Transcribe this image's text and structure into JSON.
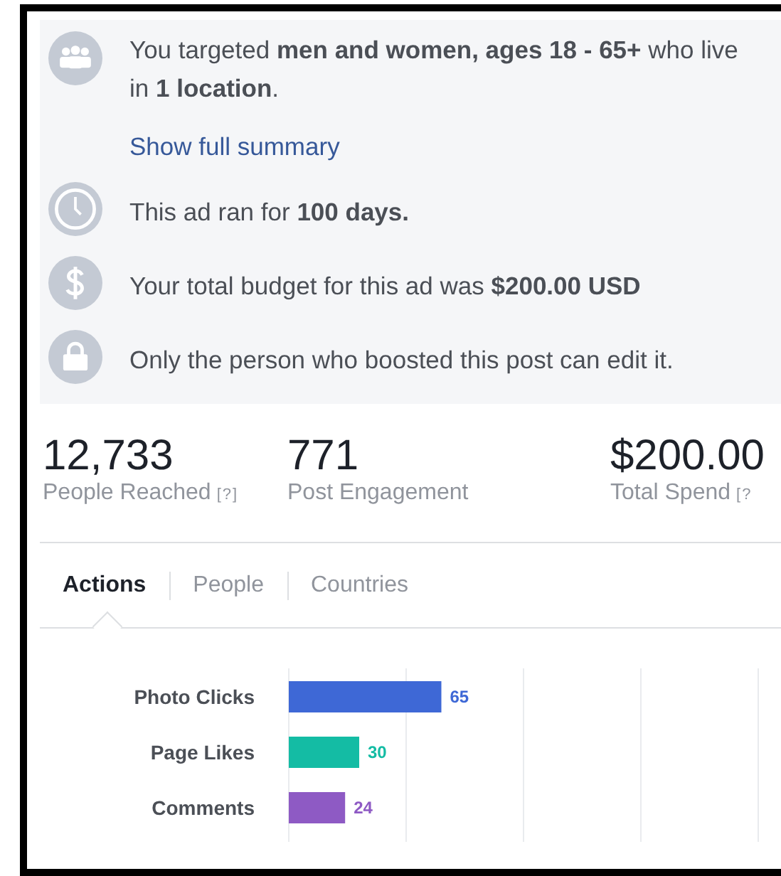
{
  "summary": {
    "items": [
      {
        "kind": "audience",
        "text": "You targeted **men and women, ages 18 - 65+** who live in **1 location**.",
        "link": "Show full summary"
      },
      {
        "kind": "duration",
        "text": "This ad ran for **100 days.**"
      },
      {
        "kind": "budget",
        "text": "Your total budget for this ad was **$200.00 USD**"
      },
      {
        "kind": "lock",
        "text": "Only the person who boosted this post can edit it."
      }
    ]
  },
  "stats": [
    {
      "value": "12,733",
      "label": "People Reached",
      "help": "[?]"
    },
    {
      "value": "771",
      "label": "Post Engagement"
    },
    {
      "value": "$200.00",
      "label": "Total Spend",
      "help": "[?"
    }
  ],
  "tabs": [
    {
      "label": "Actions",
      "selected": true
    },
    {
      "label": "People",
      "selected": false
    },
    {
      "label": "Countries",
      "selected": false
    }
  ],
  "chart_data": {
    "type": "bar",
    "orientation": "horizontal",
    "categories": [
      "Photo Clicks",
      "Page Likes",
      "Comments"
    ],
    "values": [
      65,
      30,
      24
    ],
    "colors": [
      "#3e68d6",
      "#14bca4",
      "#8e5ac4"
    ],
    "xlim": [
      0,
      200
    ],
    "data_labels": true
  }
}
